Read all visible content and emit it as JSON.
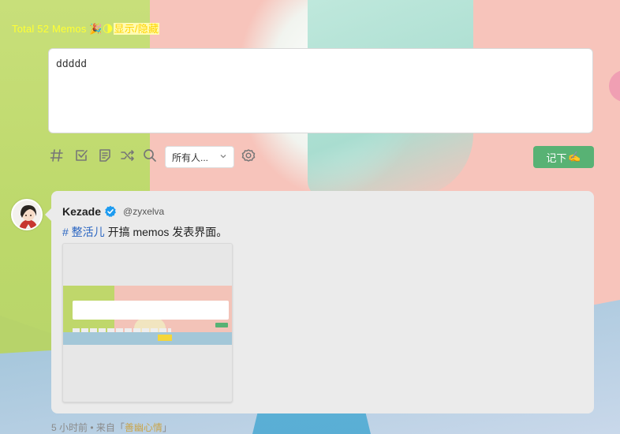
{
  "header": {
    "total_prefix": "Total 52 Memos ",
    "party_emoji": "🎉",
    "moon_emoji": "🌗",
    "toggle_link": "显示/隐藏"
  },
  "editor": {
    "value": "ddddd"
  },
  "toolbar": {
    "icons": [
      "hash-icon",
      "checkbox-icon",
      "document-icon",
      "shuffle-icon",
      "search-icon"
    ],
    "visibility_select": "所有人...",
    "submit_label": "记下",
    "submit_emoji": "✍️"
  },
  "memo": {
    "author_name": "Kezade",
    "author_handle": "@zyxelva",
    "tag": "# 整活儿",
    "content": " 开搞 memos 发表界面。",
    "meta_time": "5 小时前 • 来自「",
    "meta_source": "善幽心情",
    "meta_end": "」"
  },
  "colors": {
    "accent_green": "#58b274",
    "tag_blue": "#2b66c2",
    "total_yellow": "#ffff33",
    "verified_blue": "#1d9bf0"
  }
}
